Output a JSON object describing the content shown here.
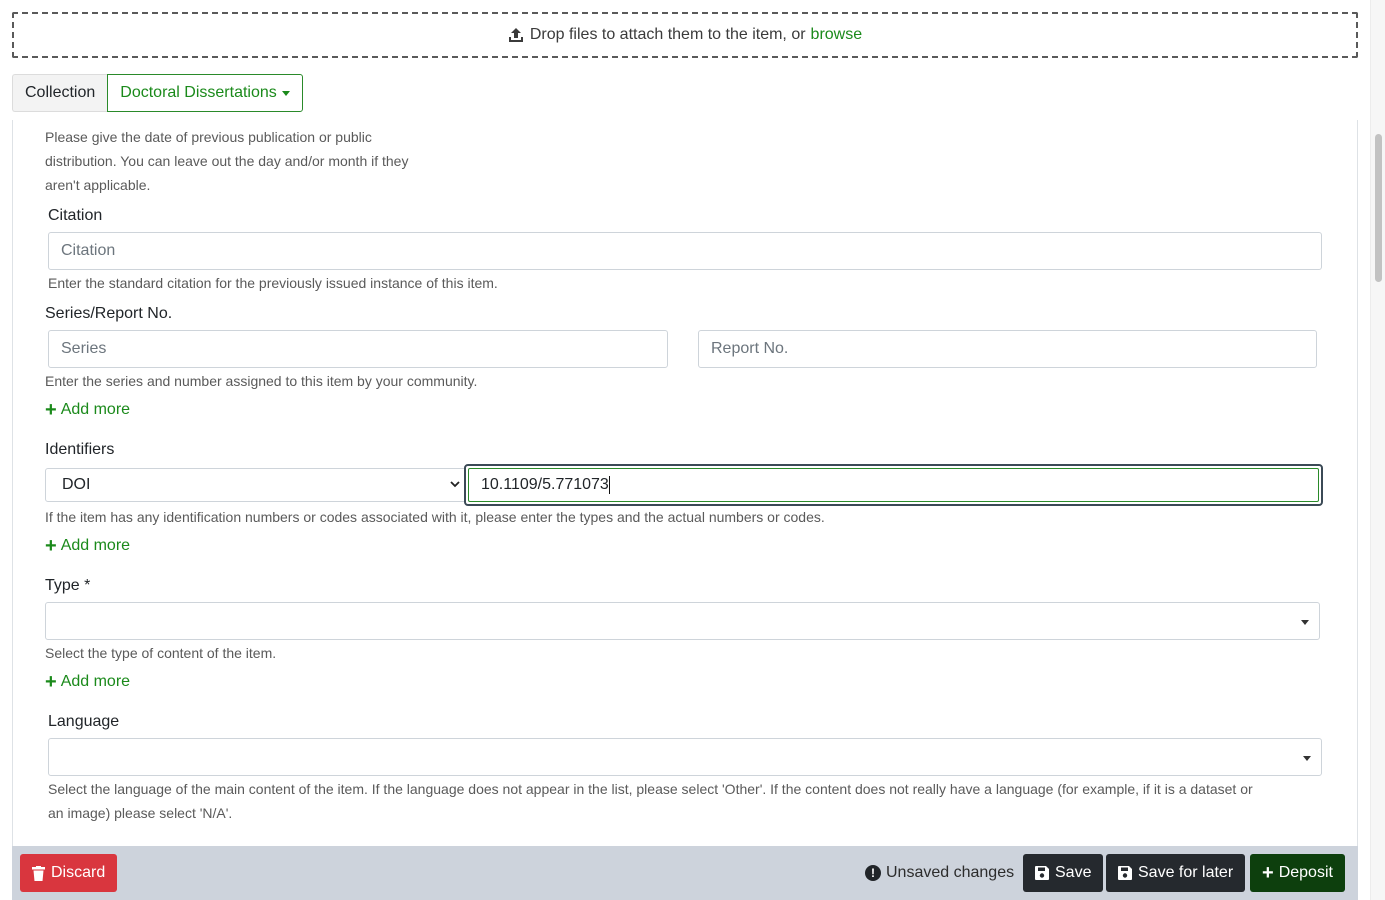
{
  "dropzone": {
    "text": "Drop files to attach them to the item, or",
    "browse": "browse"
  },
  "collection": {
    "label": "Collection",
    "value": "Doctoral Dissertations"
  },
  "form": {
    "date_help": [
      "Please give the date of previous publication or public",
      "distribution. You can leave out the day and/or month if they",
      "aren't applicable."
    ],
    "citation": {
      "label": "Citation",
      "placeholder": "Citation",
      "help": "Enter the standard citation for the previously issued instance of this item."
    },
    "series": {
      "label": "Series/Report No.",
      "series_placeholder": "Series",
      "report_placeholder": "Report No.",
      "help": "Enter the series and number assigned to this item by your community.",
      "add_more": "Add more"
    },
    "identifiers": {
      "label": "Identifiers",
      "type_value": "DOI",
      "value": "10.1109/5.771073",
      "help": "If the item has any identification numbers or codes associated with it, please enter the types and the actual numbers or codes.",
      "add_more": "Add more"
    },
    "type": {
      "label": "Type *",
      "help": "Select the type of content of the item.",
      "add_more": "Add more"
    },
    "language": {
      "label": "Language",
      "help_1": "Select the language of the main content of the item. If the language does not appear in the list, please select 'Other'. If the content does not really have a language (for example, if it is a dataset or",
      "help_2": "an image) please select 'N/A'."
    }
  },
  "footer": {
    "discard": "Discard",
    "unsaved": "Unsaved changes",
    "save": "Save",
    "save_later": "Save for later",
    "deposit": "Deposit"
  },
  "colors": {
    "accent": "#1b8a1b",
    "danger": "#d9363e",
    "deposit": "#0d3f0d",
    "footer_bg": "#cdd3dc"
  }
}
